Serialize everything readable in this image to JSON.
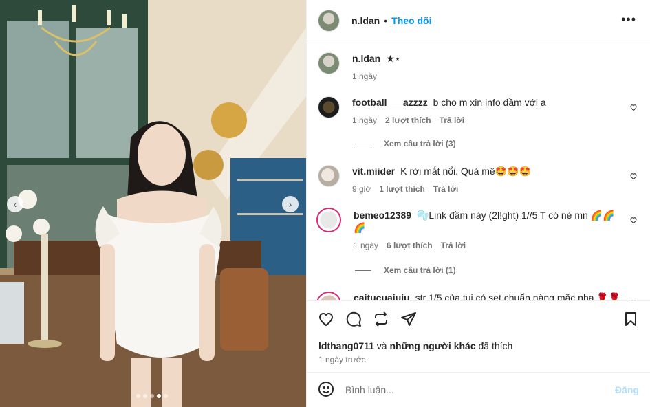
{
  "post": {
    "carousel": {
      "slide_count": 5,
      "active_index": 3
    },
    "author": {
      "username": "n.ldan",
      "follow_label": "Theo dõi",
      "separator": "•"
    }
  },
  "caption": {
    "username": "n.ldan",
    "text": "★⋆",
    "time": "1 ngày"
  },
  "comments": [
    {
      "username": "football___azzzz",
      "text": "b cho m xin info đầm với ạ",
      "time": "1 ngày",
      "likes": "2 lượt thích",
      "reply": "Trả lời",
      "view_replies": "Xem câu trả lời (3)"
    },
    {
      "username": "vit.miider",
      "text": "K rời mắt nổi. Quá mê🤩🤩🤩",
      "time": "9 giờ",
      "likes": "1 lượt thích",
      "reply": "Trả lời"
    },
    {
      "username": "bemeo12389",
      "text": "🫧Link đầm này (2l!ght) 1//5 T có nè mn 🌈🌈🌈",
      "time": "1 ngày",
      "likes": "6 lượt thích",
      "reply": "Trả lời",
      "view_replies": "Xem câu trả lời (1)"
    },
    {
      "username": "caitucuaiuiu",
      "text": "str 1/5 của tui có set chuẩn nàng mặc nha 🌹🌹"
    }
  ],
  "likes_line": {
    "user": "ldthang0711",
    "connector": " và ",
    "others": "những người khác",
    "suffix": " đã thích"
  },
  "timestamp": "1 ngày trước",
  "comment_box": {
    "placeholder": "Bình luận...",
    "post_label": "Đăng"
  },
  "colors": {
    "accent": "#0095f6",
    "post_disabled": "#b2dffc",
    "muted": "#737373"
  }
}
